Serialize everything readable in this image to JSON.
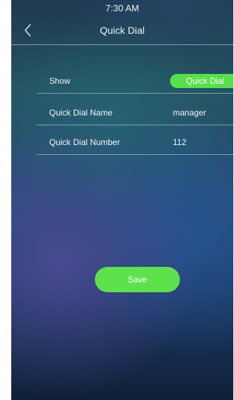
{
  "status_bar": {
    "time": "7:30 AM"
  },
  "header": {
    "title": "Quick Dial",
    "back_icon": "chevron-left-icon"
  },
  "form": {
    "show": {
      "label": "Show",
      "value": "Quick Dial"
    },
    "name": {
      "label": "Quick Dial Name",
      "value": "manager"
    },
    "number": {
      "label": "Quick Dial Number",
      "value": "112"
    }
  },
  "actions": {
    "save_label": "Save"
  },
  "colors": {
    "accent_green": "#57e04c",
    "text": "#f2f6f8",
    "divider": "#dce6f0"
  }
}
